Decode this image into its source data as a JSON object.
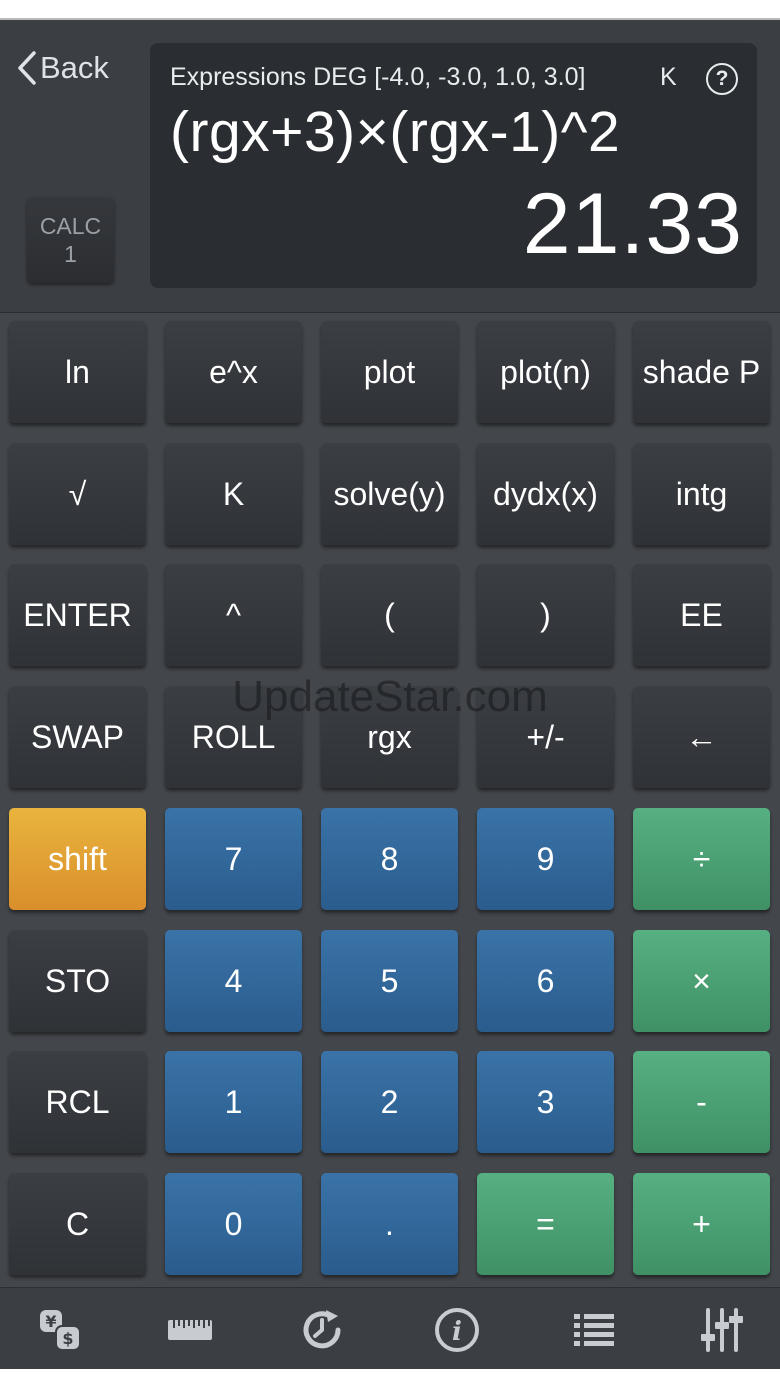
{
  "header": {
    "back_label": "Back",
    "calc_label": "CALC",
    "calc_number": "1"
  },
  "display": {
    "mode_text": "Expressions DEG [-4.0, -3.0, 1.0, 3.0]",
    "k_label": "K",
    "help_label": "?",
    "expression": "(rgx+3)×(rgx-1)^2",
    "result": "21.33"
  },
  "keypad": {
    "rows": [
      [
        {
          "label": "ln",
          "style": "dark",
          "name": "key-ln"
        },
        {
          "label": "e^x",
          "style": "dark",
          "name": "key-exp"
        },
        {
          "label": "plot",
          "style": "dark",
          "name": "key-plot"
        },
        {
          "label": "plot(n)",
          "style": "dark",
          "name": "key-plot-n"
        },
        {
          "label": "shade P",
          "style": "dark",
          "name": "key-shade-p"
        }
      ],
      [
        {
          "label": "√",
          "style": "dark",
          "name": "key-sqrt"
        },
        {
          "label": "K",
          "style": "dark",
          "name": "key-k"
        },
        {
          "label": "solve(y)",
          "style": "dark",
          "name": "key-solve-y"
        },
        {
          "label": "dydx(x)",
          "style": "dark",
          "name": "key-dydx"
        },
        {
          "label": "intg",
          "style": "dark",
          "name": "key-intg"
        }
      ],
      [
        {
          "label": "ENTER",
          "style": "dark",
          "name": "key-enter"
        },
        {
          "label": "^",
          "style": "dark",
          "name": "key-power"
        },
        {
          "label": "(",
          "style": "dark",
          "name": "key-open-paren"
        },
        {
          "label": ")",
          "style": "dark",
          "name": "key-close-paren"
        },
        {
          "label": "EE",
          "style": "dark",
          "name": "key-ee"
        }
      ],
      [
        {
          "label": "SWAP",
          "style": "dark",
          "name": "key-swap"
        },
        {
          "label": "ROLL",
          "style": "dark",
          "name": "key-roll"
        },
        {
          "label": "rgx",
          "style": "dark",
          "name": "key-rgx"
        },
        {
          "label": "+/-",
          "style": "dark",
          "name": "key-negate"
        },
        {
          "label": "←",
          "style": "dark",
          "name": "key-backspace"
        }
      ],
      [
        {
          "label": "shift",
          "style": "orange",
          "name": "key-shift"
        },
        {
          "label": "7",
          "style": "blue",
          "name": "key-7"
        },
        {
          "label": "8",
          "style": "blue",
          "name": "key-8"
        },
        {
          "label": "9",
          "style": "blue",
          "name": "key-9"
        },
        {
          "label": "÷",
          "style": "green",
          "name": "key-divide"
        }
      ],
      [
        {
          "label": "STO",
          "style": "dark",
          "name": "key-sto"
        },
        {
          "label": "4",
          "style": "blue",
          "name": "key-4"
        },
        {
          "label": "5",
          "style": "blue",
          "name": "key-5"
        },
        {
          "label": "6",
          "style": "blue",
          "name": "key-6"
        },
        {
          "label": "×",
          "style": "green",
          "name": "key-multiply"
        }
      ],
      [
        {
          "label": "RCL",
          "style": "dark",
          "name": "key-rcl"
        },
        {
          "label": "1",
          "style": "blue",
          "name": "key-1"
        },
        {
          "label": "2",
          "style": "blue",
          "name": "key-2"
        },
        {
          "label": "3",
          "style": "blue",
          "name": "key-3"
        },
        {
          "label": "-",
          "style": "green",
          "name": "key-subtract"
        }
      ],
      [
        {
          "label": "C",
          "style": "dark",
          "name": "key-clear"
        },
        {
          "label": "0",
          "style": "blue",
          "name": "key-0"
        },
        {
          "label": ".",
          "style": "blue",
          "name": "key-decimal"
        },
        {
          "label": "=",
          "style": "green",
          "name": "key-equals"
        },
        {
          "label": "+",
          "style": "green",
          "name": "key-add"
        }
      ]
    ]
  },
  "watermark": "UpdateStar.com",
  "tabbar": {
    "items": [
      {
        "icon": "currency-exchange-icon"
      },
      {
        "icon": "ruler-icon"
      },
      {
        "icon": "history-clock-icon"
      },
      {
        "icon": "info-icon"
      },
      {
        "icon": "list-icon"
      },
      {
        "icon": "sliders-icon"
      }
    ]
  },
  "colors": {
    "key_dark": "#33363a",
    "key_blue": "#3268a0",
    "key_green": "#4aa273",
    "key_orange": "#e3a335",
    "display_bg": "#2a2d31",
    "panel_bg": "#3b3e43"
  }
}
